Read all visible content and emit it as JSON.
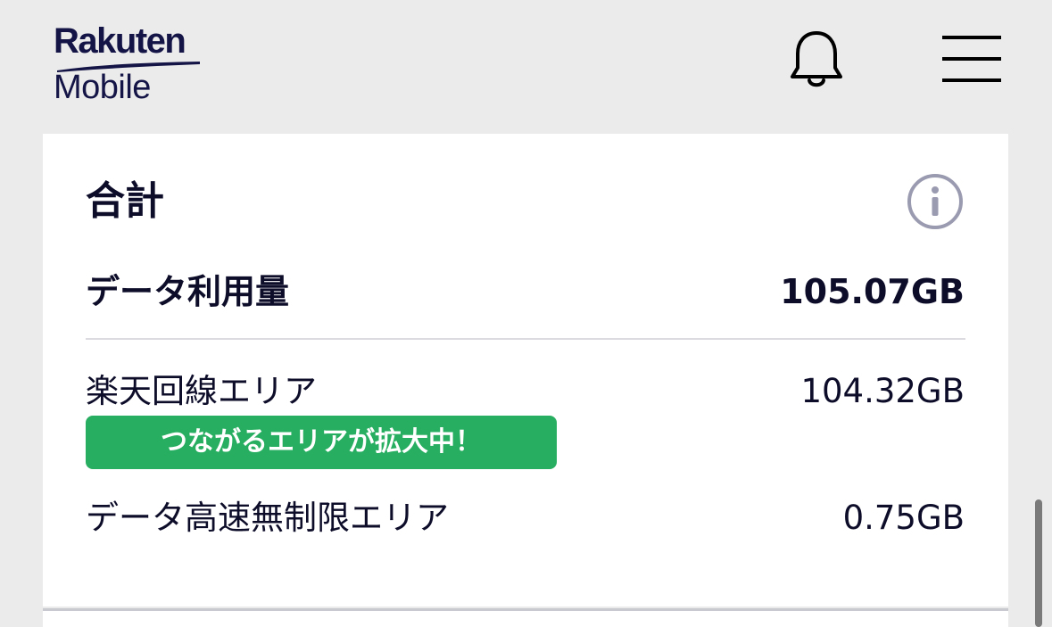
{
  "header": {
    "logo_line1": "Rakuten",
    "logo_line2": "Mobile",
    "notification_icon": "bell-icon",
    "menu_icon": "hamburger-menu-icon"
  },
  "summary": {
    "title": "合計",
    "info_icon": "info-icon",
    "total_label": "データ利用量",
    "total_value": "105.07GB",
    "rows": [
      {
        "label": "楽天回線エリア",
        "value": "104.32GB",
        "badge": "つながるエリアが拡大中！"
      },
      {
        "label": "データ高速無制限エリア",
        "value": "0.75GB"
      }
    ]
  },
  "colors": {
    "header_bg": "#ebebeb",
    "card_bg": "#ffffff",
    "text": "#0d0d2a",
    "badge_bg": "#27ae60",
    "info_icon": "#9a9ab0"
  }
}
